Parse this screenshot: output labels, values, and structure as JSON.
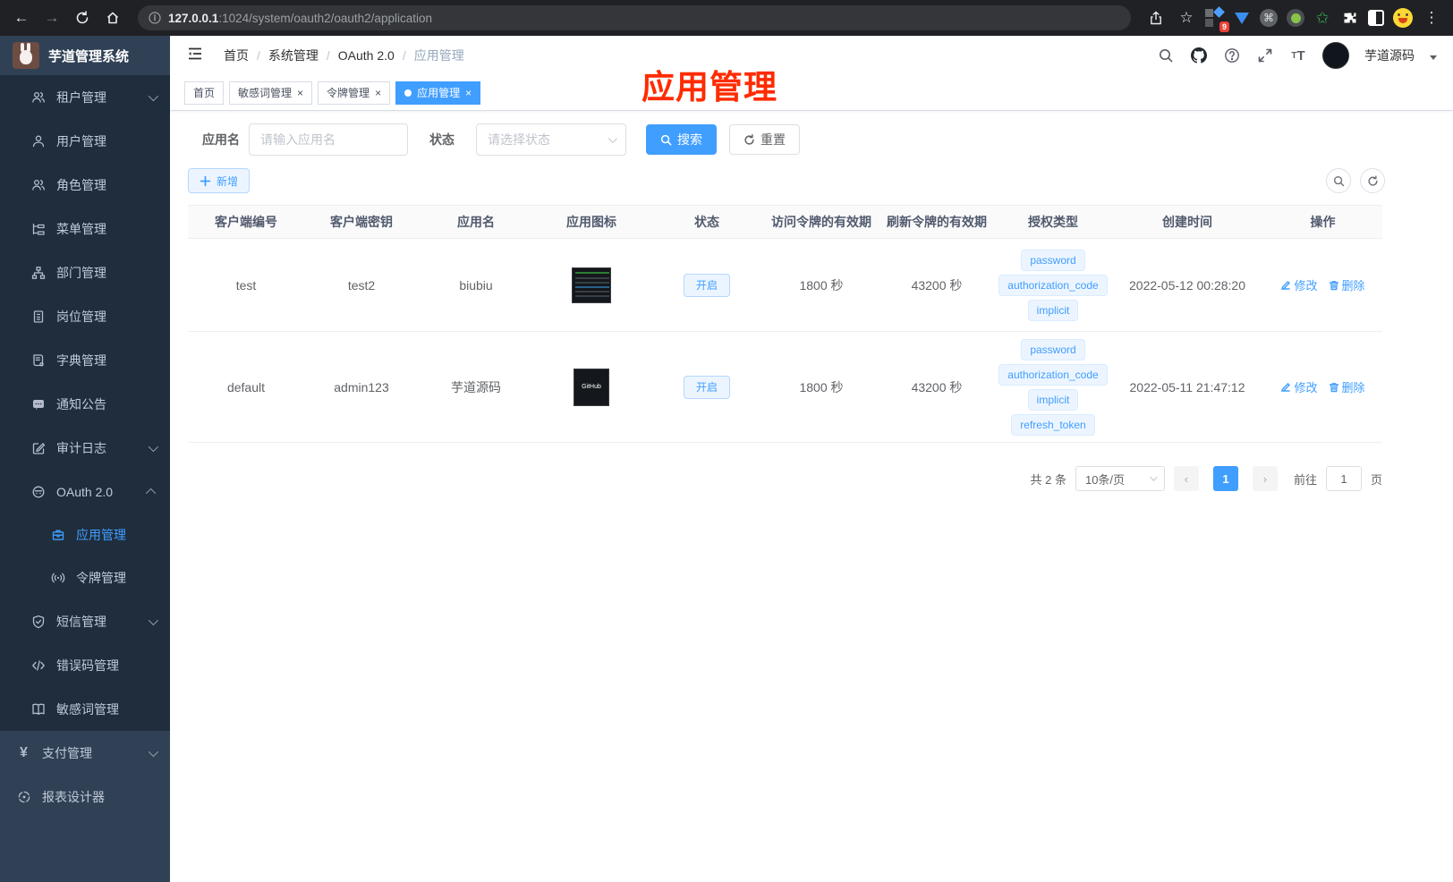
{
  "browser": {
    "url_host": "127.0.0.1",
    "url_rest": ":1024/system/oauth2/oauth2/application",
    "ext_badge": "9"
  },
  "sidebar": {
    "title": "芋道管理系统",
    "items": [
      {
        "label": "租户管理"
      },
      {
        "label": "用户管理"
      },
      {
        "label": "角色管理"
      },
      {
        "label": "菜单管理"
      },
      {
        "label": "部门管理"
      },
      {
        "label": "岗位管理"
      },
      {
        "label": "字典管理"
      },
      {
        "label": "通知公告"
      },
      {
        "label": "审计日志"
      },
      {
        "label": "OAuth 2.0"
      },
      {
        "label": "应用管理"
      },
      {
        "label": "令牌管理"
      },
      {
        "label": "短信管理"
      },
      {
        "label": "错误码管理"
      },
      {
        "label": "敏感词管理"
      },
      {
        "label": "支付管理"
      },
      {
        "label": "报表设计器"
      }
    ]
  },
  "navbar": {
    "breadcrumb": [
      "首页",
      "系统管理",
      "OAuth 2.0",
      "应用管理"
    ],
    "username": "芋道源码"
  },
  "tabs": [
    {
      "label": "首页"
    },
    {
      "label": "敏感词管理"
    },
    {
      "label": "令牌管理"
    },
    {
      "label": "应用管理"
    }
  ],
  "annotation": "应用管理",
  "filter": {
    "name_label": "应用名",
    "name_placeholder": "请输入应用名",
    "status_label": "状态",
    "status_placeholder": "请选择状态",
    "search_label": "搜索",
    "reset_label": "重置"
  },
  "toolbar": {
    "add_label": "新增"
  },
  "table": {
    "columns": [
      "客户端编号",
      "客户端密钥",
      "应用名",
      "应用图标",
      "状态",
      "访问令牌的有效期",
      "刷新令牌的有效期",
      "授权类型",
      "创建时间",
      "操作"
    ],
    "rows": [
      {
        "client_id": "test",
        "secret": "test2",
        "name": "biubiu",
        "status": "开启",
        "access": "1800 秒",
        "refresh": "43200 秒",
        "grants": [
          "password",
          "authorization_code",
          "implicit"
        ],
        "created": "2022-05-12 00:28:20",
        "edit": "修改",
        "delete": "删除"
      },
      {
        "client_id": "default",
        "secret": "admin123",
        "name": "芋道源码",
        "icon_text": "GitHub",
        "status": "开启",
        "access": "1800 秒",
        "refresh": "43200 秒",
        "grants": [
          "password",
          "authorization_code",
          "implicit",
          "refresh_token"
        ],
        "created": "2022-05-11 21:47:12",
        "edit": "修改",
        "delete": "删除"
      }
    ]
  },
  "pagination": {
    "total": "共 2 条",
    "page_size": "10条/页",
    "current": "1",
    "goto_label": "前往",
    "goto_value": "1",
    "page_unit": "页"
  },
  "colors": {
    "accent": "#409eff",
    "sidebar_bg": "#304156",
    "sidebar_sub_bg": "#1f2d3d",
    "annotation": "#ff2b00"
  }
}
